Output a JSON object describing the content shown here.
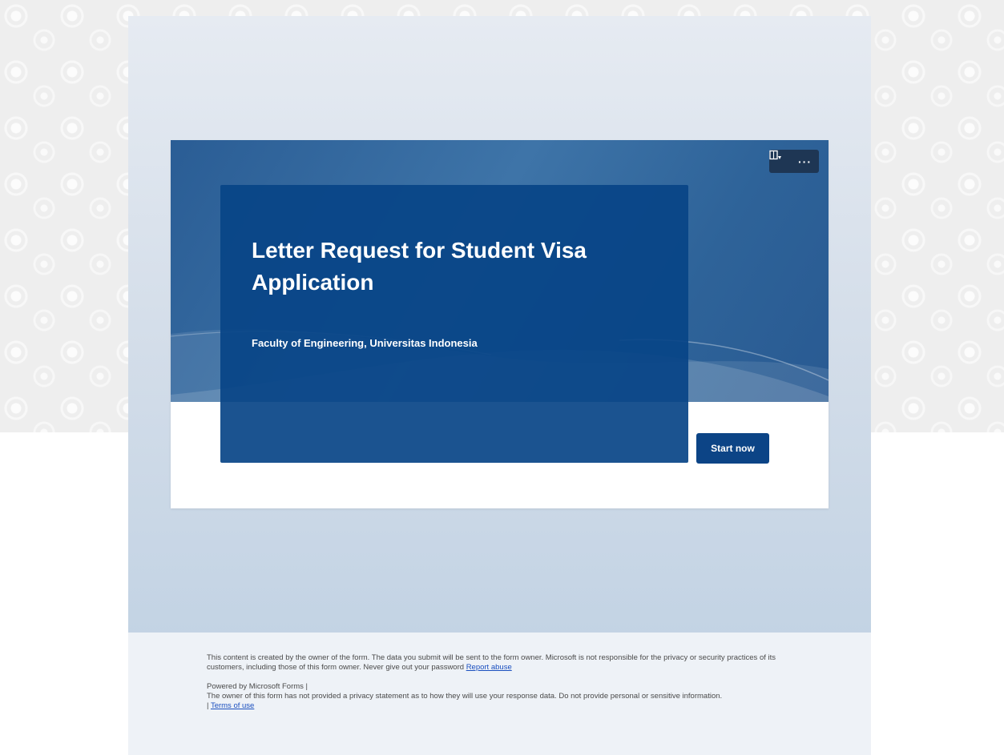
{
  "form": {
    "title": "Letter Request for Student Visa Application",
    "subtitle": "Faculty of Engineering, Universitas Indonesia",
    "start_button_label": "Start now",
    "toolbar": {
      "immersive_reader_icon": "immersive-reader-icon",
      "more_options_label": "···"
    }
  },
  "footer": {
    "disclaimer": "This content is created by the owner of the form. The data you submit will be sent to the form owner. Microsoft is not responsible for the privacy or security practices of its customers, including those of this form owner. Never give out your password ",
    "report_abuse_link": "Report abuse",
    "powered_by": "Powered by Microsoft Forms |",
    "privacy_notice": "The owner of this form has not provided a privacy statement as to how they will use your response data. Do not provide personal or sensitive information.",
    "terms_prefix": "| ",
    "terms_link": "Terms of use"
  },
  "colors": {
    "banner": "#2e6399",
    "title_panel": "#0c4486",
    "start_button": "#0c4486",
    "link": "#1a4fbf"
  }
}
